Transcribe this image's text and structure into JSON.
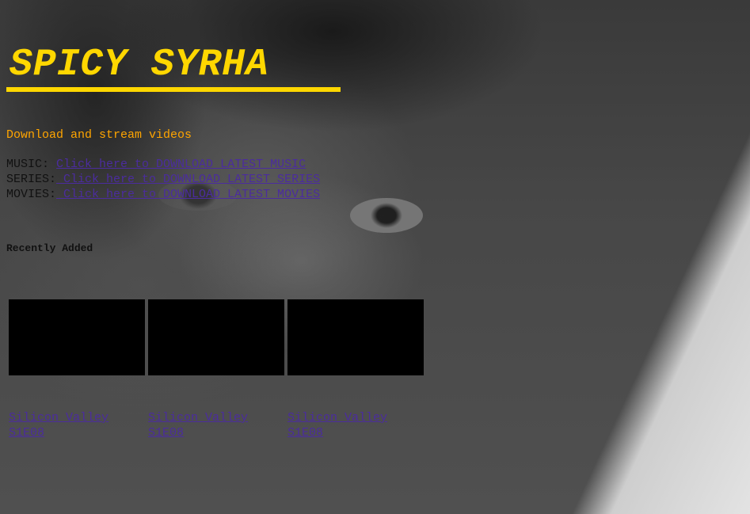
{
  "site": {
    "title": "SPICY SYRHA",
    "tagline": "Download and stream videos"
  },
  "links": [
    {
      "label": "MUSIC:",
      "text": "Click here to DOWNLOAD LATEST MUSIC"
    },
    {
      "label": "SERIES:",
      "text": " Click here to DOWNLOAD LATEST SERIES"
    },
    {
      "label": "MOVIES:",
      "text": " Click here to DOWNLOAD LATEST MOVIES"
    }
  ],
  "recent": {
    "heading": "Recently Added",
    "items": [
      {
        "title": "Silicon Valley",
        "episode": "S1E08"
      },
      {
        "title": "Silicon Valley",
        "episode": "S1E08"
      },
      {
        "title": "Silicon Valley",
        "episode": "S1E08"
      }
    ]
  },
  "colors": {
    "title": "#ffd700",
    "tagline": "#ffa500",
    "link": "#4b2c9e",
    "thumbnail": "#000000"
  }
}
